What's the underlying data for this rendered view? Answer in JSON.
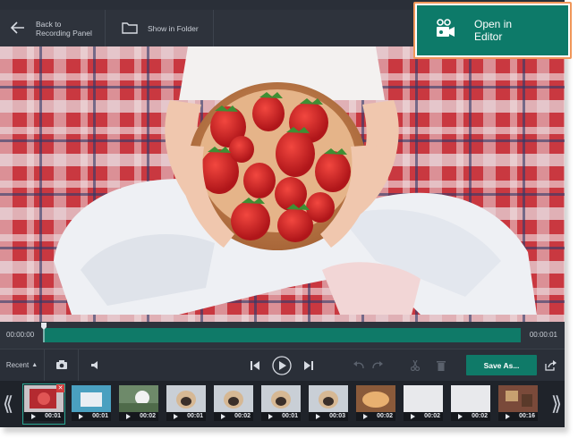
{
  "topbar": {
    "back_label_line1": "Back to",
    "back_label_line2": "Recording Panel",
    "folder_label": "Show in Folder",
    "editor_label_line1": "Open in",
    "editor_label_line2": "Editor"
  },
  "timeline": {
    "start_time": "00:00:00",
    "end_time": "00:00:01",
    "playhead_position": 0.0
  },
  "controls": {
    "recent_label": "Recent",
    "save_label": "Save As..."
  },
  "filmstrip": {
    "thumbs": [
      {
        "duration": "00:01",
        "selected": true,
        "kind": "strawberry"
      },
      {
        "duration": "00:01",
        "selected": false,
        "kind": "blue"
      },
      {
        "duration": "00:02",
        "selected": false,
        "kind": "ball"
      },
      {
        "duration": "00:01",
        "selected": false,
        "kind": "pug"
      },
      {
        "duration": "00:02",
        "selected": false,
        "kind": "pug"
      },
      {
        "duration": "00:01",
        "selected": false,
        "kind": "pug"
      },
      {
        "duration": "00:03",
        "selected": false,
        "kind": "pug"
      },
      {
        "duration": "00:02",
        "selected": false,
        "kind": "food"
      },
      {
        "duration": "00:02",
        "selected": false,
        "kind": "white"
      },
      {
        "duration": "00:02",
        "selected": false,
        "kind": "white"
      },
      {
        "duration": "00:16",
        "selected": false,
        "kind": "room"
      }
    ]
  },
  "colors": {
    "accent": "#0f7a68",
    "highlight_border": "#f0975a"
  }
}
